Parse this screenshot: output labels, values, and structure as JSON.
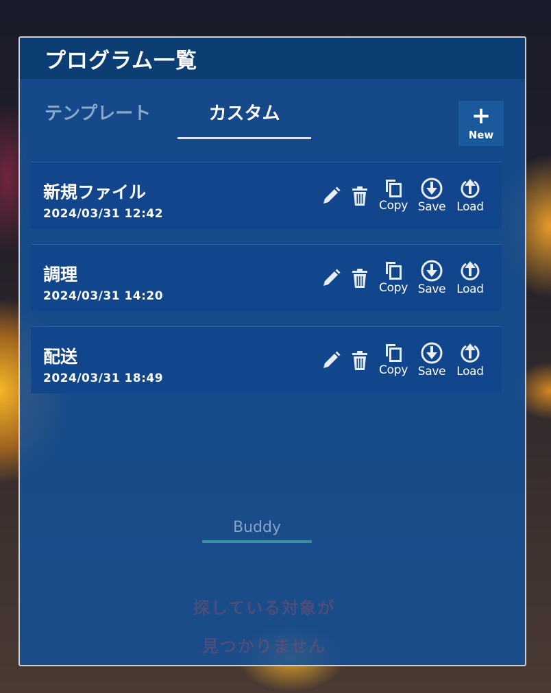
{
  "header": {
    "title": "プログラム一覧"
  },
  "tabs": [
    {
      "label": "テンプレート",
      "active": false
    },
    {
      "label": "カスタム",
      "active": true
    }
  ],
  "new_button": {
    "icon": "plus-icon",
    "label": "New"
  },
  "actions": {
    "copy_label": "Copy",
    "save_label": "Save",
    "load_label": "Load"
  },
  "files": [
    {
      "name": "新規ファイル",
      "date": "2024/03/31 12:42"
    },
    {
      "name": "調理",
      "date": "2024/03/31 14:20"
    },
    {
      "name": "配送",
      "date": "2024/03/31 18:49"
    }
  ],
  "buddy": {
    "label": "Buddy"
  },
  "empty_message": {
    "line1": "探している対象が",
    "line2": "見つかりません"
  },
  "colors": {
    "panel_bg": "#1d5b9e",
    "header_bg": "#0c3d73",
    "item_bg": "#124a8e",
    "buddy_bar": "#3c8f9c"
  }
}
